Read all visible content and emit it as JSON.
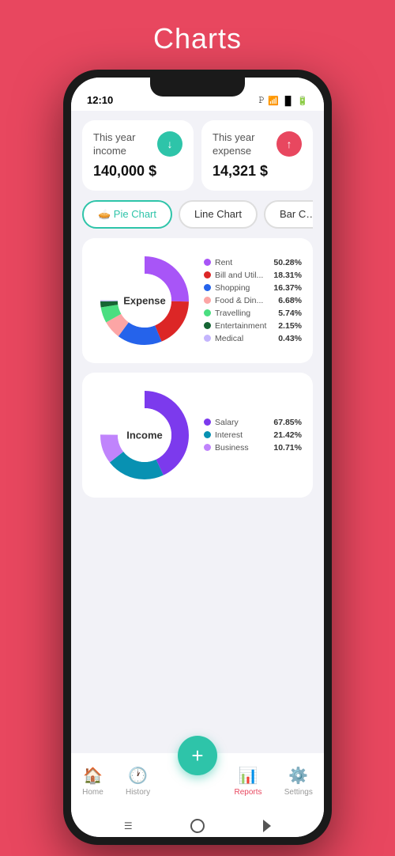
{
  "page": {
    "title": "Charts",
    "background": "#e8475f"
  },
  "status_bar": {
    "time": "12:10",
    "privacy_icon": "P"
  },
  "summary_cards": [
    {
      "label": "This year income",
      "value": "140,000 $",
      "icon_direction": "↓",
      "icon_color": "green"
    },
    {
      "label": "This year expense",
      "value": "14,321 $",
      "icon_direction": "↑",
      "icon_color": "red"
    }
  ],
  "chart_tabs": [
    {
      "label": "🥧 Pie Chart",
      "active": true
    },
    {
      "label": "Line Chart",
      "active": false
    },
    {
      "label": "Bar C…",
      "active": false
    }
  ],
  "expense_chart": {
    "title": "Expense",
    "legend": [
      {
        "color": "#a855f7",
        "name": "Rent",
        "pct": "50.28%"
      },
      {
        "color": "#dc2626",
        "name": "Bill and Util...",
        "pct": "18.31%"
      },
      {
        "color": "#2563eb",
        "name": "Shopping",
        "pct": "16.37%"
      },
      {
        "color": "#fca5a5",
        "name": "Food & Din...",
        "pct": "6.68%"
      },
      {
        "color": "#4ade80",
        "name": "Travelling",
        "pct": "5.74%"
      },
      {
        "color": "#166534",
        "name": "Entertainment",
        "pct": "2.15%"
      },
      {
        "color": "#c4b5fd",
        "name": "Medical",
        "pct": "0.43%"
      }
    ],
    "segments": [
      {
        "color": "#a855f7",
        "pct": 50.28
      },
      {
        "color": "#dc2626",
        "pct": 18.31
      },
      {
        "color": "#2563eb",
        "pct": 16.37
      },
      {
        "color": "#fca5a5",
        "pct": 6.68
      },
      {
        "color": "#4ade80",
        "pct": 5.74
      },
      {
        "color": "#166534",
        "pct": 2.15
      },
      {
        "color": "#c4b5fd",
        "pct": 0.43
      }
    ]
  },
  "income_chart": {
    "title": "Income",
    "legend": [
      {
        "color": "#7c3aed",
        "name": "Salary",
        "pct": "67.85%"
      },
      {
        "color": "#0891b2",
        "name": "Interest",
        "pct": "21.42%"
      },
      {
        "color": "#c084fc",
        "name": "Business",
        "pct": "10.71%"
      }
    ],
    "segments": [
      {
        "color": "#7c3aed",
        "pct": 67.85
      },
      {
        "color": "#0891b2",
        "pct": 21.42
      },
      {
        "color": "#c084fc",
        "pct": 10.71
      }
    ]
  },
  "bottom_nav": {
    "items": [
      {
        "label": "Home",
        "active": false
      },
      {
        "label": "History",
        "active": false
      },
      {
        "label": "Reports",
        "active": true
      },
      {
        "label": "Settings",
        "active": false
      }
    ],
    "fab_label": "+"
  }
}
